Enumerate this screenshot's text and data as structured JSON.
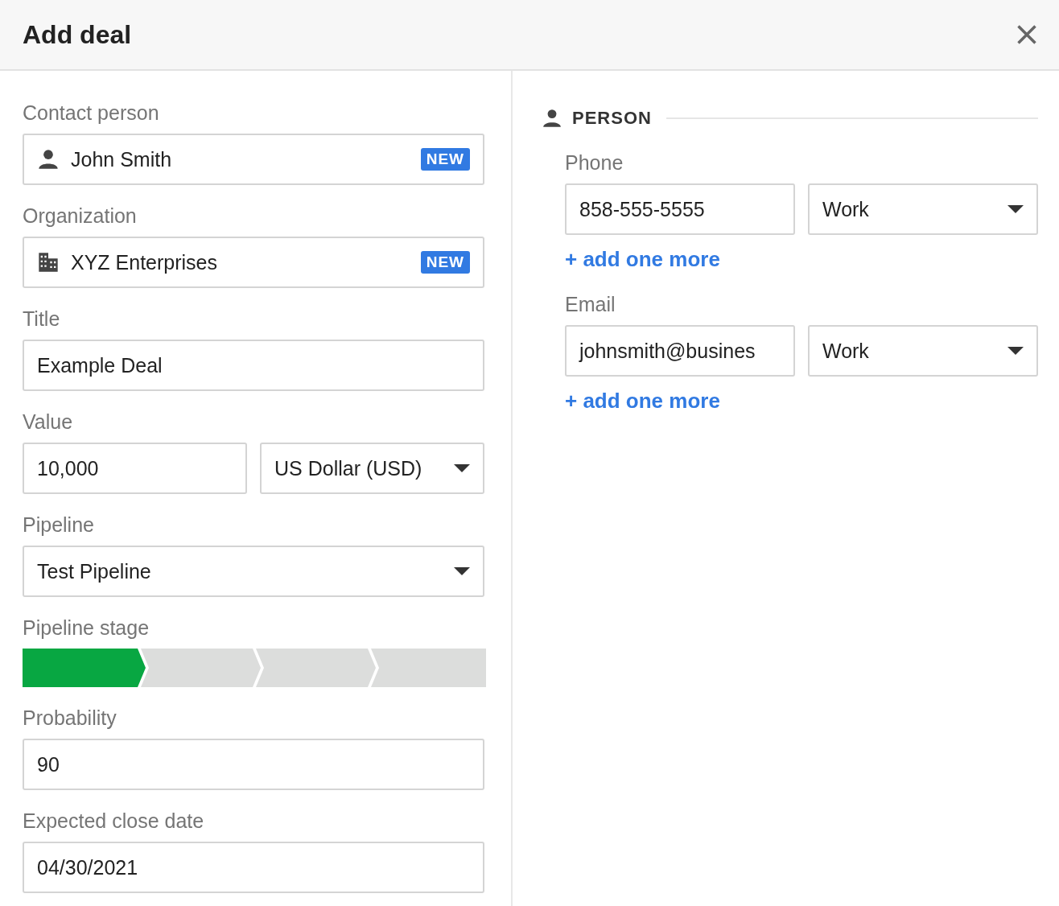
{
  "dialog": {
    "title": "Add deal"
  },
  "left": {
    "fields": [
      {
        "kind": "contact",
        "label": "Contact person",
        "value": "John Smith",
        "badge": "NEW"
      },
      {
        "kind": "organization",
        "label": "Organization",
        "value": "XYZ Enterprises",
        "badge": "NEW"
      },
      {
        "kind": "text",
        "label": "Title",
        "value": "Example Deal"
      },
      {
        "kind": "money",
        "label": "Value",
        "value": "10,000",
        "currency": "US Dollar (USD)"
      },
      {
        "kind": "select",
        "label": "Pipeline",
        "value": "Test Pipeline"
      },
      {
        "kind": "stages",
        "label": "Pipeline stage",
        "stages": [
          {
            "reached": true
          },
          {
            "reached": false
          },
          {
            "reached": false
          },
          {
            "reached": false
          }
        ]
      },
      {
        "kind": "text",
        "label": "Probability",
        "value": "90"
      },
      {
        "kind": "text",
        "label": "Expected close date",
        "value": "04/30/2021"
      }
    ]
  },
  "right": {
    "section_title": "PERSON",
    "groups": [
      {
        "label": "Phone",
        "value": "858-555-5555",
        "type": "Work",
        "add_link": "+ add one more"
      },
      {
        "label": "Email",
        "value": "johnsmith@busines",
        "type": "Work",
        "add_link": "+ add one more"
      }
    ]
  }
}
